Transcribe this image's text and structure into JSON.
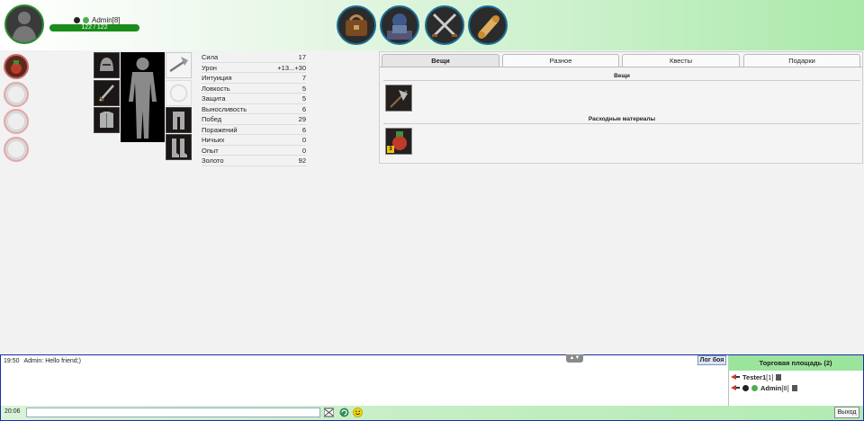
{
  "user": {
    "name": "Admin[8]",
    "hp": "122 / 122"
  },
  "stats": [
    {
      "label": "Сила",
      "value": "17"
    },
    {
      "label": "Урон",
      "value": "+13...+30"
    },
    {
      "label": "Интуиция",
      "value": "7"
    },
    {
      "label": "Ловкость",
      "value": "5"
    },
    {
      "label": "Защита",
      "value": "5"
    },
    {
      "label": "Выносливость",
      "value": "6"
    },
    {
      "label": "Побед",
      "value": "29"
    },
    {
      "label": "Поражений",
      "value": "6"
    },
    {
      "label": "Ничьих",
      "value": "0"
    },
    {
      "label": "Опыт",
      "value": "0"
    },
    {
      "label": "Золото",
      "value": "92"
    }
  ],
  "tabs": [
    "Вещи",
    "Разное",
    "Квесты",
    "Подарки"
  ],
  "inventory": {
    "section_items": "Вещи",
    "section_consumables": "Расходные материалы",
    "consumable_count": "3"
  },
  "chat": {
    "message_time": "19:50",
    "message_text": "Admin: Hello friend;)",
    "log_button": "Лог боя",
    "current_time": "20:06",
    "exit_button": "Выход"
  },
  "trade": {
    "title": "Торговая площадь (2)",
    "users": [
      {
        "name": "Tester1",
        "level": "[1]"
      },
      {
        "name": "Admin",
        "level": "[8]"
      }
    ]
  },
  "colors": {
    "accent_green": "#1a8c1a",
    "chat_border": "#1a2eaa"
  }
}
